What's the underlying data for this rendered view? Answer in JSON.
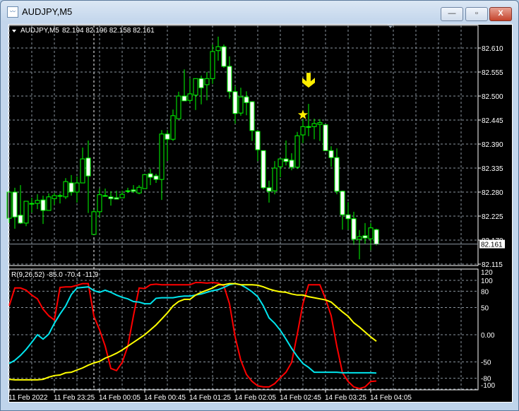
{
  "window": {
    "title": "AUDJPY,M5",
    "minimize": "—",
    "maximize": "▫",
    "close": "X"
  },
  "header": {
    "symbol_label": "AUDJPY,M5",
    "ohlc": "82.194 82.196 82.158 82.161"
  },
  "indicator": {
    "label": "R(9,26,52) -85.0 -70.4 -11.9"
  },
  "colors": {
    "bull_border": "#00ff00",
    "bear_fill": "#ffffff",
    "grid": "#8c96a0",
    "red": "#ff0000",
    "cyan": "#00e5ee",
    "yellow": "#ffff00",
    "marker": "#ffee00"
  },
  "chart_data": [
    {
      "type": "candlestick",
      "title": "AUDJPY,M5",
      "last_price": "82.161",
      "y_ticks": [
        "82.610",
        "82.555",
        "82.500",
        "82.445",
        "82.390",
        "82.335",
        "82.280",
        "82.225",
        "82.170",
        "82.115"
      ],
      "ylim": [
        82.113,
        82.665
      ],
      "x_ticks": [
        "11 Feb 2022",
        "11 Feb 23:25",
        "14 Feb 00:05",
        "14 Feb 00:45",
        "14 Feb 01:25",
        "14 Feb 02:05",
        "14 Feb 02:45",
        "14 Feb 03:25",
        "14 Feb 04:05"
      ],
      "ohlc": [
        [
          82.22,
          82.283,
          82.209,
          82.28
        ],
        [
          82.28,
          82.29,
          82.196,
          82.223
        ],
        [
          82.227,
          82.296,
          82.207,
          82.209
        ],
        [
          82.209,
          82.259,
          82.202,
          82.259
        ],
        [
          82.254,
          82.267,
          82.233,
          82.254
        ],
        [
          82.254,
          82.275,
          82.241,
          82.261
        ],
        [
          82.262,
          82.272,
          82.207,
          82.238
        ],
        [
          82.238,
          82.277,
          82.238,
          82.269
        ],
        [
          82.265,
          82.278,
          82.251,
          82.272
        ],
        [
          82.272,
          82.277,
          82.254,
          82.272
        ],
        [
          82.269,
          82.312,
          82.264,
          82.304
        ],
        [
          82.301,
          82.319,
          82.272,
          82.28
        ],
        [
          82.28,
          82.316,
          82.256,
          82.301
        ],
        [
          82.301,
          82.382,
          82.301,
          82.356
        ],
        [
          82.358,
          82.398,
          82.232,
          82.317
        ],
        [
          82.183,
          82.24,
          82.183,
          82.235
        ],
        [
          82.235,
          82.288,
          82.222,
          82.274
        ],
        [
          82.272,
          82.288,
          82.272,
          82.272
        ],
        [
          82.269,
          82.282,
          82.249,
          82.265
        ],
        [
          82.267,
          82.283,
          82.264,
          82.264
        ],
        [
          82.267,
          82.283,
          82.267,
          82.275
        ],
        [
          82.283,
          82.29,
          82.278,
          82.283
        ],
        [
          82.285,
          82.296,
          82.278,
          82.282
        ],
        [
          82.278,
          82.296,
          82.275,
          82.291
        ],
        [
          82.288,
          82.32,
          82.288,
          82.32
        ],
        [
          82.322,
          82.333,
          82.296,
          82.314
        ],
        [
          82.317,
          82.322,
          82.301,
          82.309
        ],
        [
          82.309,
          82.422,
          82.262,
          82.413
        ],
        [
          82.413,
          82.422,
          82.351,
          82.401
        ],
        [
          82.401,
          82.469,
          82.397,
          82.455
        ],
        [
          82.448,
          82.51,
          82.448,
          82.5
        ],
        [
          82.5,
          82.561,
          82.489,
          82.489
        ],
        [
          82.49,
          82.54,
          82.484,
          82.505
        ],
        [
          82.502,
          82.54,
          82.468,
          82.54
        ],
        [
          82.54,
          82.547,
          82.481,
          82.519
        ],
        [
          82.526,
          82.555,
          82.49,
          82.54
        ],
        [
          82.54,
          82.618,
          82.528,
          82.602
        ],
        [
          82.604,
          82.636,
          82.581,
          82.613
        ],
        [
          82.613,
          82.618,
          82.565,
          82.568
        ],
        [
          82.568,
          82.591,
          82.494,
          82.51
        ],
        [
          82.51,
          82.523,
          82.437,
          82.46
        ],
        [
          82.461,
          82.519,
          82.455,
          82.498
        ],
        [
          82.498,
          82.511,
          82.456,
          82.485
        ],
        [
          82.487,
          82.487,
          82.397,
          82.421
        ],
        [
          82.419,
          82.422,
          82.351,
          82.377
        ],
        [
          82.375,
          82.375,
          82.286,
          82.29
        ],
        [
          82.29,
          82.306,
          82.256,
          82.282
        ],
        [
          82.283,
          82.351,
          82.275,
          82.335
        ],
        [
          82.338,
          82.356,
          82.314,
          82.356
        ],
        [
          82.356,
          82.398,
          82.341,
          82.35
        ],
        [
          82.353,
          82.369,
          82.33,
          82.337
        ],
        [
          82.337,
          82.418,
          82.333,
          82.409
        ],
        [
          82.411,
          82.447,
          82.392,
          82.43
        ],
        [
          82.43,
          82.482,
          82.408,
          82.43
        ],
        [
          82.43,
          82.448,
          82.401,
          82.437
        ],
        [
          82.435,
          82.447,
          82.397,
          82.439
        ],
        [
          82.434,
          82.434,
          82.375,
          82.375
        ],
        [
          82.375,
          82.385,
          82.338,
          82.359
        ],
        [
          82.359,
          82.38,
          82.275,
          82.282
        ],
        [
          82.282,
          82.283,
          82.194,
          82.228
        ],
        [
          82.228,
          82.257,
          82.194,
          82.219
        ],
        [
          82.219,
          82.235,
          82.159,
          82.172
        ],
        [
          82.172,
          82.193,
          82.126,
          82.178
        ],
        [
          82.18,
          82.209,
          82.162,
          82.175
        ],
        [
          82.173,
          82.209,
          82.147,
          82.198
        ],
        [
          82.194,
          82.196,
          82.158,
          82.161
        ]
      ],
      "markers": [
        {
          "type": "star",
          "candle": 52
        },
        {
          "type": "down-arrow",
          "candle": 53
        }
      ]
    },
    {
      "type": "line",
      "title": "R(9,26,52)",
      "y_ticks": [
        "120",
        "100",
        "80",
        "50",
        "0.00",
        "-50",
        "-80",
        "-100"
      ],
      "ylim": [
        -100,
        120
      ],
      "series": [
        {
          "name": "R9",
          "color": "#ff0000",
          "values": [
            53,
            86,
            86,
            82,
            73,
            66,
            47,
            35,
            27,
            87,
            88,
            88,
            91,
            94,
            94,
            34,
            9,
            -21,
            -62,
            -66,
            -51,
            -21,
            35,
            86,
            85,
            92,
            93,
            92,
            92,
            92,
            92,
            92,
            92,
            96,
            96,
            95,
            96,
            95,
            90,
            57,
            -4,
            -47,
            -73,
            -86,
            -94,
            -96,
            -96,
            -90,
            -79,
            -69,
            -51,
            1,
            57,
            92,
            92,
            92,
            66,
            35,
            -21,
            -70,
            -86,
            -96,
            -99,
            -96,
            -86,
            -85
          ]
        },
        {
          "name": "R26",
          "color": "#00e5ee",
          "values": [
            -53,
            -47,
            -38,
            -27,
            -14,
            0,
            -8,
            1,
            21,
            38,
            53,
            74,
            86,
            87,
            88,
            81,
            78,
            82,
            78,
            73,
            69,
            66,
            61,
            60,
            57,
            57,
            67,
            68,
            68,
            68,
            70,
            71,
            71,
            73,
            75,
            78,
            81,
            83,
            87,
            92,
            94,
            92,
            86,
            79,
            70,
            53,
            31,
            21,
            8,
            -8,
            -25,
            -40,
            -53,
            -60,
            -69,
            -69,
            -69,
            -69,
            -69,
            -70,
            -70,
            -70,
            -70,
            -70,
            -70,
            -70.4
          ]
        },
        {
          "name": "R52",
          "color": "#ffff00",
          "values": [
            -82,
            -83,
            -83,
            -83,
            -83,
            -83,
            -82,
            -78,
            -75,
            -74,
            -70,
            -69,
            -65,
            -61,
            -56,
            -52,
            -49,
            -43,
            -39,
            -34,
            -28,
            -21,
            -14,
            -7,
            0,
            9,
            18,
            29,
            40,
            53,
            61,
            65,
            65,
            73,
            78,
            82,
            86,
            92,
            92,
            94,
            94,
            92,
            92,
            92,
            91,
            88,
            84,
            81,
            79,
            78,
            75,
            73,
            73,
            70,
            68,
            66,
            64,
            60,
            51,
            42,
            34,
            22,
            14,
            5,
            -4,
            -11.9
          ]
        }
      ]
    }
  ]
}
